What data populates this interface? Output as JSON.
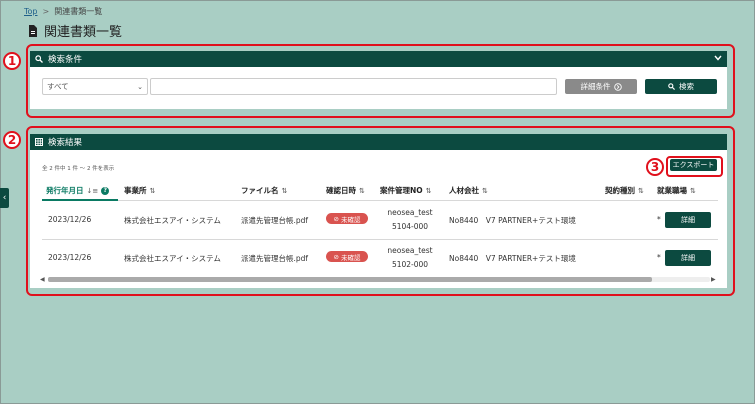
{
  "breadcrumb": {
    "top": "Top",
    "separator": ">",
    "current": "関連書類一覧"
  },
  "page": {
    "title": "関連書類一覧"
  },
  "markers": [
    "1",
    "2",
    "3"
  ],
  "search_panel": {
    "title": "検索条件",
    "select_value": "すべて",
    "input_value": "",
    "advanced_label": "詳細条件",
    "search_label": "検索"
  },
  "results_panel": {
    "title": "検索結果",
    "count_text": "全 2 件中 1 件 〜 2 件を表示",
    "export_label": "エクスポート",
    "columns": [
      "発行年月日",
      "事業所",
      "ファイル名",
      "確認日時",
      "案件管理NO",
      "人材会社",
      "契約種別",
      "就業職場"
    ],
    "rows": [
      {
        "date": "2023/12/26",
        "office": "株式会社エスアイ・システム",
        "file": "派遣先管理台帳.pdf",
        "status": "未確認",
        "case_no_line1": "neosea_test",
        "case_no_line2": "5104-000",
        "company": "No8440　V7 PARTNER+テスト環境",
        "contract_type": "",
        "workplace": "*",
        "action": "詳細"
      },
      {
        "date": "2023/12/26",
        "office": "株式会社エスアイ・システム",
        "file": "派遣先管理台帳.pdf",
        "status": "未確認",
        "case_no_line1": "neosea_test",
        "case_no_line2": "5102-000",
        "company": "No8440　V7 PARTNER+テスト環境",
        "contract_type": "",
        "workplace": "*",
        "action": "詳細"
      }
    ]
  },
  "colors": {
    "dark_green": "#0c4a40",
    "accent_green": "#0a7a63",
    "marker_red": "#e0101c",
    "status_red": "#d9534f",
    "background": "#a9cec4"
  }
}
